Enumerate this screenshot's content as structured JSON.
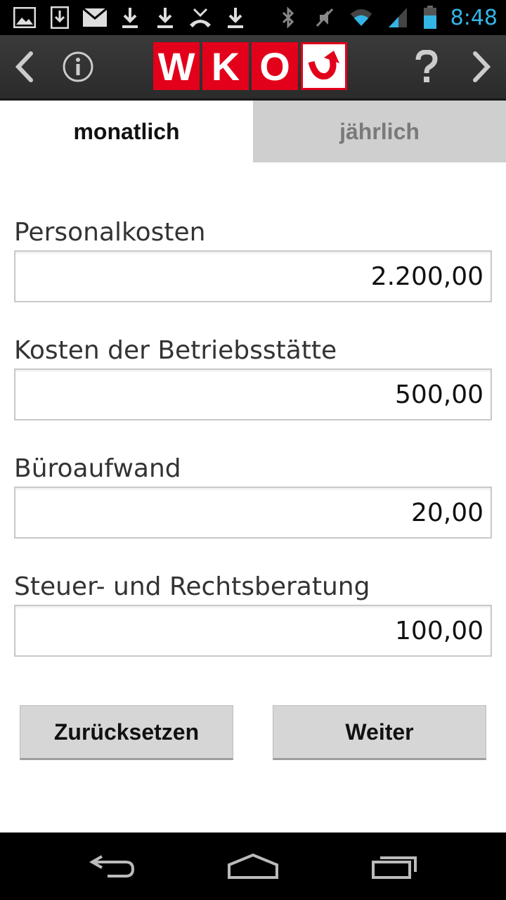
{
  "status_bar": {
    "time": "8:48",
    "left_icons": [
      "image-icon",
      "download-box-icon",
      "mail-icon",
      "download-icon",
      "download-icon",
      "missed-call-icon",
      "download-icon"
    ],
    "right_icons": [
      "bluetooth-icon",
      "mute-icon",
      "wifi-icon",
      "signal-icon",
      "battery-icon"
    ],
    "time_color": "#33b5e5"
  },
  "action_bar": {
    "logo_letters": [
      "W",
      "K",
      "O"
    ],
    "brand_color": "#e2001a"
  },
  "tabs": [
    {
      "label": "monatlich",
      "active": true
    },
    {
      "label": "jährlich",
      "active": false
    }
  ],
  "fields": [
    {
      "label": "Personalkosten",
      "value": "2.200,00"
    },
    {
      "label": "Kosten der Betriebsstätte",
      "value": "500,00"
    },
    {
      "label": "Büroaufwand",
      "value": "20,00"
    },
    {
      "label": "Steuer- und Rechtsberatung",
      "value": "100,00"
    }
  ],
  "buttons": {
    "reset": "Zurücksetzen",
    "next": "Weiter"
  }
}
